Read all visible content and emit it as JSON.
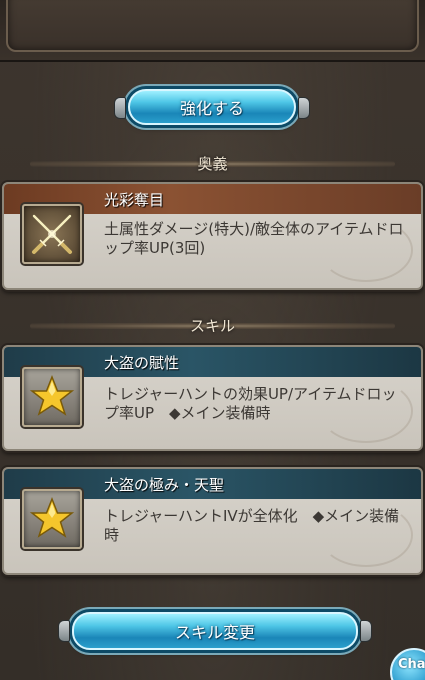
{
  "buttons": {
    "enhance_label": "強化する",
    "skill_change_label": "スキル変更",
    "chat_label": "Cha"
  },
  "sections": {
    "ougi_header": "奥義",
    "skill_header": "スキル"
  },
  "ougi": {
    "name": "光彩奪目",
    "description": "土属性ダメージ(特大)/敵全体のアイテムドロップ率UP(3回)",
    "icon": "crossed-swords-icon"
  },
  "skills": [
    {
      "name": "大盗の賦性",
      "description": "トレジャーハントの効果UP/アイテムドロップ率UP　◆メイン装備時",
      "icon": "star-icon"
    },
    {
      "name": "大盗の極み・天聖",
      "description": "トレジャーハントIVが全体化　◆メイン装備時",
      "icon": "star-icon"
    }
  ],
  "colors": {
    "ougi_header": "#8b5233",
    "skill_header": "#2a5566",
    "button_blue": "#4ec6e6"
  }
}
